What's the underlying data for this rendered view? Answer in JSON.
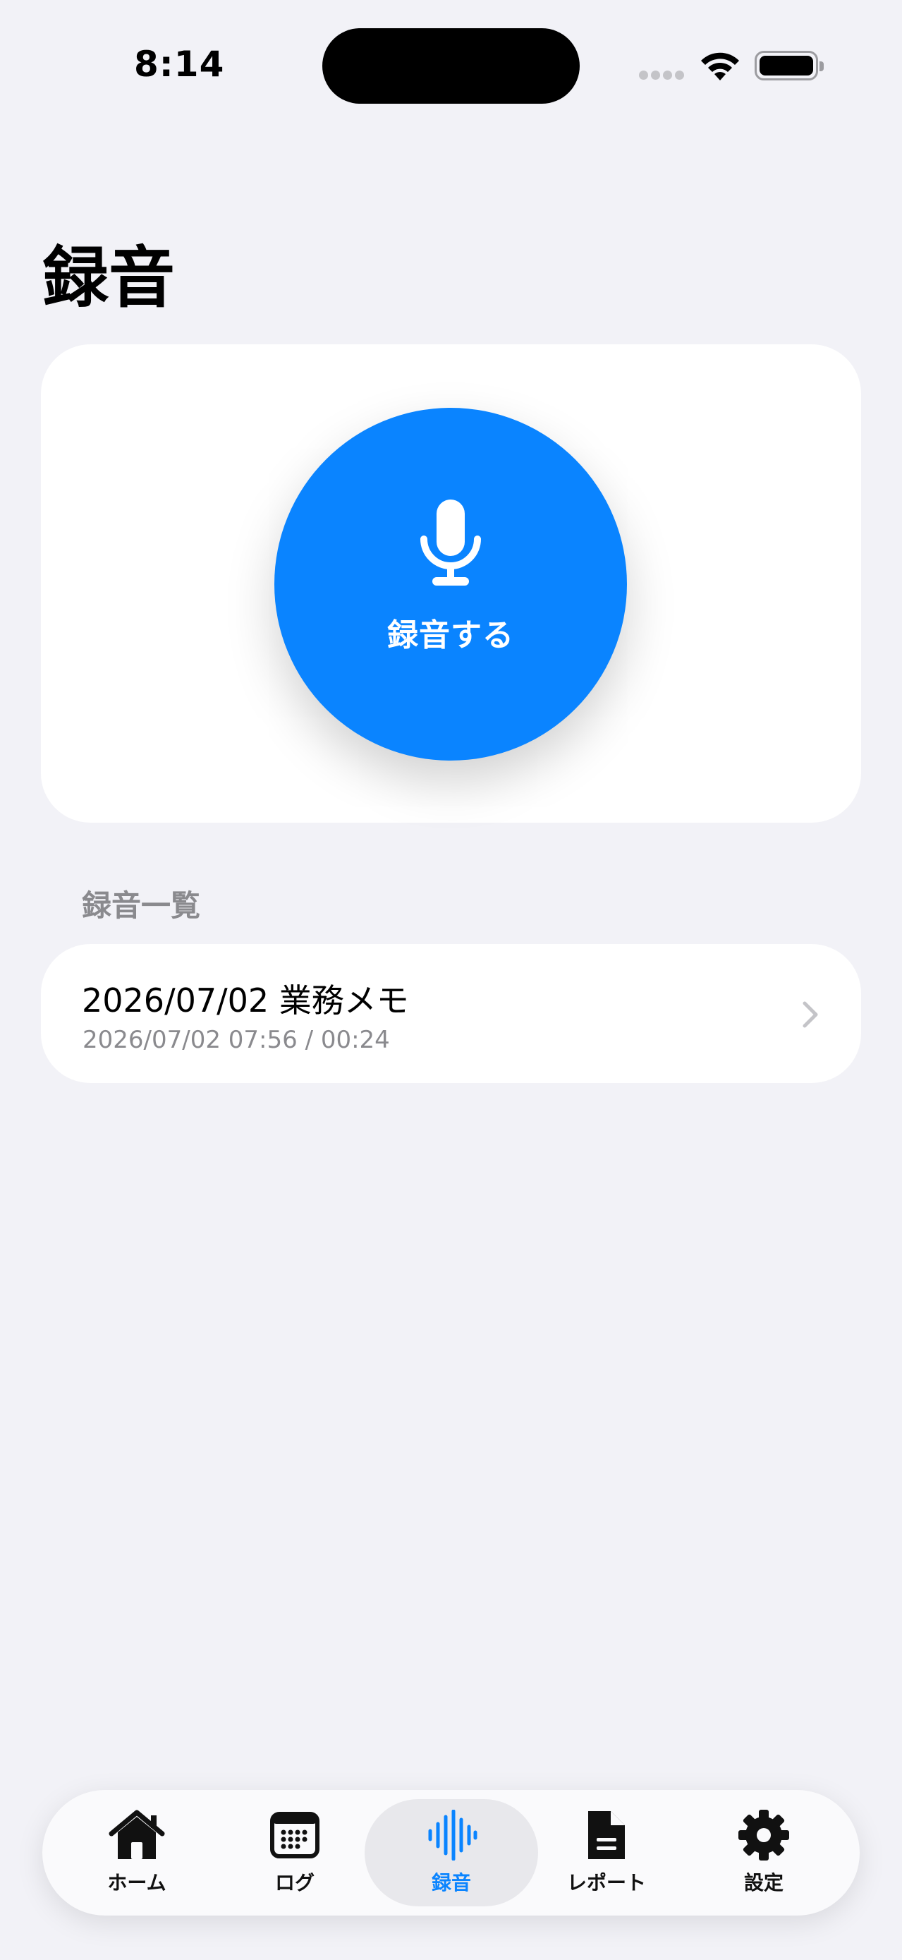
{
  "status_bar": {
    "time": "8:14"
  },
  "page": {
    "title": "録音"
  },
  "record": {
    "button_label": "録音する",
    "icon": "microphone-icon",
    "accent_color": "#0a84ff"
  },
  "recordings": {
    "section_title": "録音一覧",
    "items": [
      {
        "title": "2026/07/02 業務メモ",
        "subtitle": "2026/07/02 07:56 / 00:24"
      }
    ]
  },
  "tab_bar": {
    "active": "録音",
    "tabs": [
      {
        "label": "ホーム",
        "icon": "house-icon"
      },
      {
        "label": "ログ",
        "icon": "calendar-icon"
      },
      {
        "label": "録音",
        "icon": "waveform-icon"
      },
      {
        "label": "レポート",
        "icon": "document-icon"
      },
      {
        "label": "設定",
        "icon": "gear-icon"
      }
    ]
  }
}
